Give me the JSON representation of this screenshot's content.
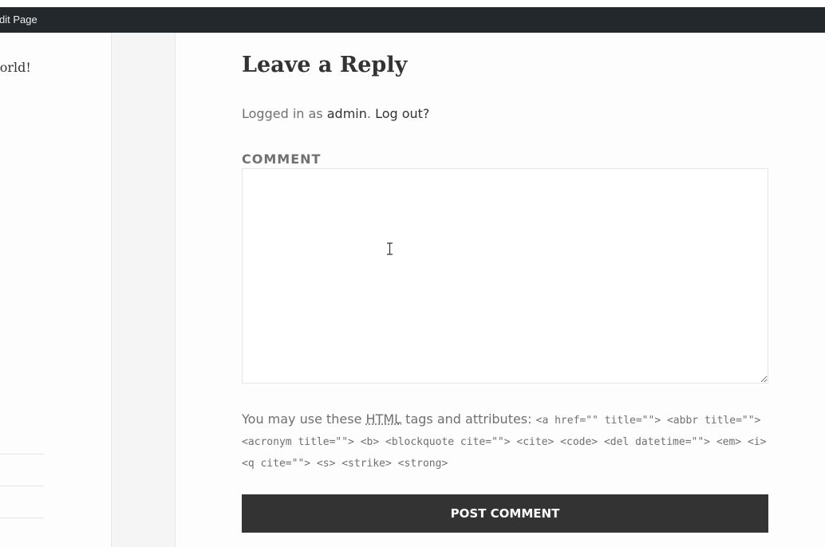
{
  "admin_bar": {
    "edit_page_label": "dit Page"
  },
  "sidebar": {
    "post_title_fragment": "world!"
  },
  "reply": {
    "title": "Leave a Reply",
    "logged_in_prefix": "Logged in as",
    "user_link": "admin",
    "logout_link": "Log out?",
    "comment_label": "COMMENT",
    "comment_value": "",
    "allowed_prefix": "You may use these",
    "allowed_abbr": "HTML",
    "allowed_suffix": "tags and attributes:",
    "allowed_tags": "<a href=\"\" title=\"\"> <abbr title=\"\"> <acronym title=\"\"> <b> <blockquote cite=\"\"> <cite> <code> <del datetime=\"\"> <em> <i> <q cite=\"\"> <s> <strike> <strong>",
    "submit_label": "POST COMMENT"
  },
  "colors": {
    "admin_bar_bg": "#23282d",
    "button_bg": "#333333",
    "muted_text": "#707070",
    "border": "#e6e6e6"
  },
  "icons": {
    "cursor": "text-cursor-icon"
  }
}
